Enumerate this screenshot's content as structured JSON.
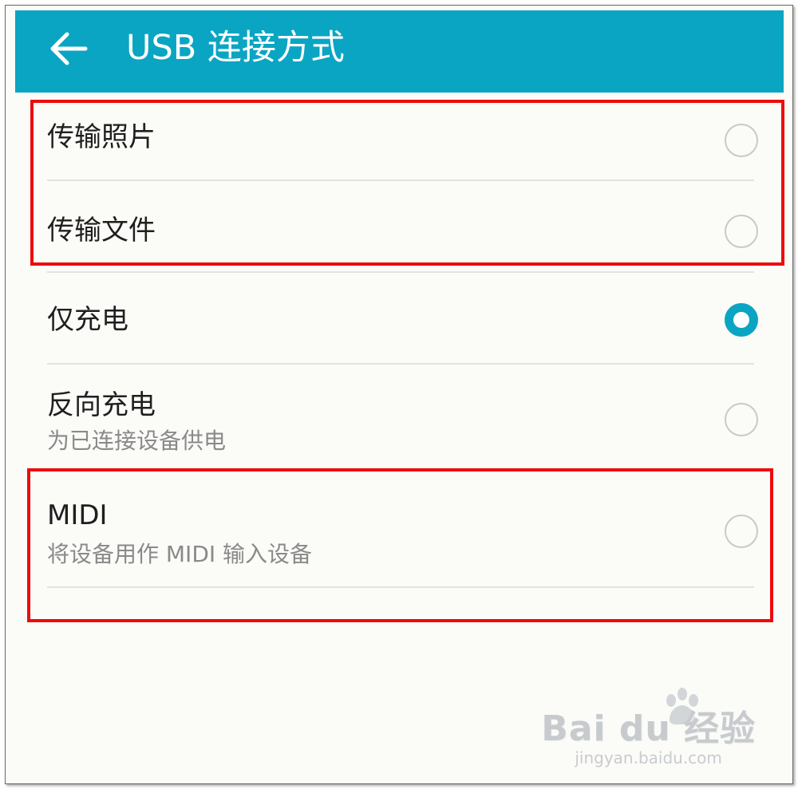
{
  "header": {
    "title": "USB 连接方式",
    "back_icon": "arrow-left-icon"
  },
  "options": [
    {
      "label": "传输照片",
      "subtitle": "",
      "selected": false
    },
    {
      "label": "传输文件",
      "subtitle": "",
      "selected": false
    },
    {
      "label": "仅充电",
      "subtitle": "",
      "selected": true
    },
    {
      "label": "反向充电",
      "subtitle": "为已连接设备供电",
      "selected": false
    },
    {
      "label": "MIDI",
      "subtitle": "将设备用作 MIDI 输入设备",
      "selected": false
    }
  ],
  "colors": {
    "accent": "#0aa5c3",
    "highlight": "#ee0b0b",
    "background": "#fbfbf8"
  },
  "watermark": {
    "brand": "Bai du 经验",
    "url": "jingyan.baidu.com",
    "icon": "paw-icon"
  }
}
